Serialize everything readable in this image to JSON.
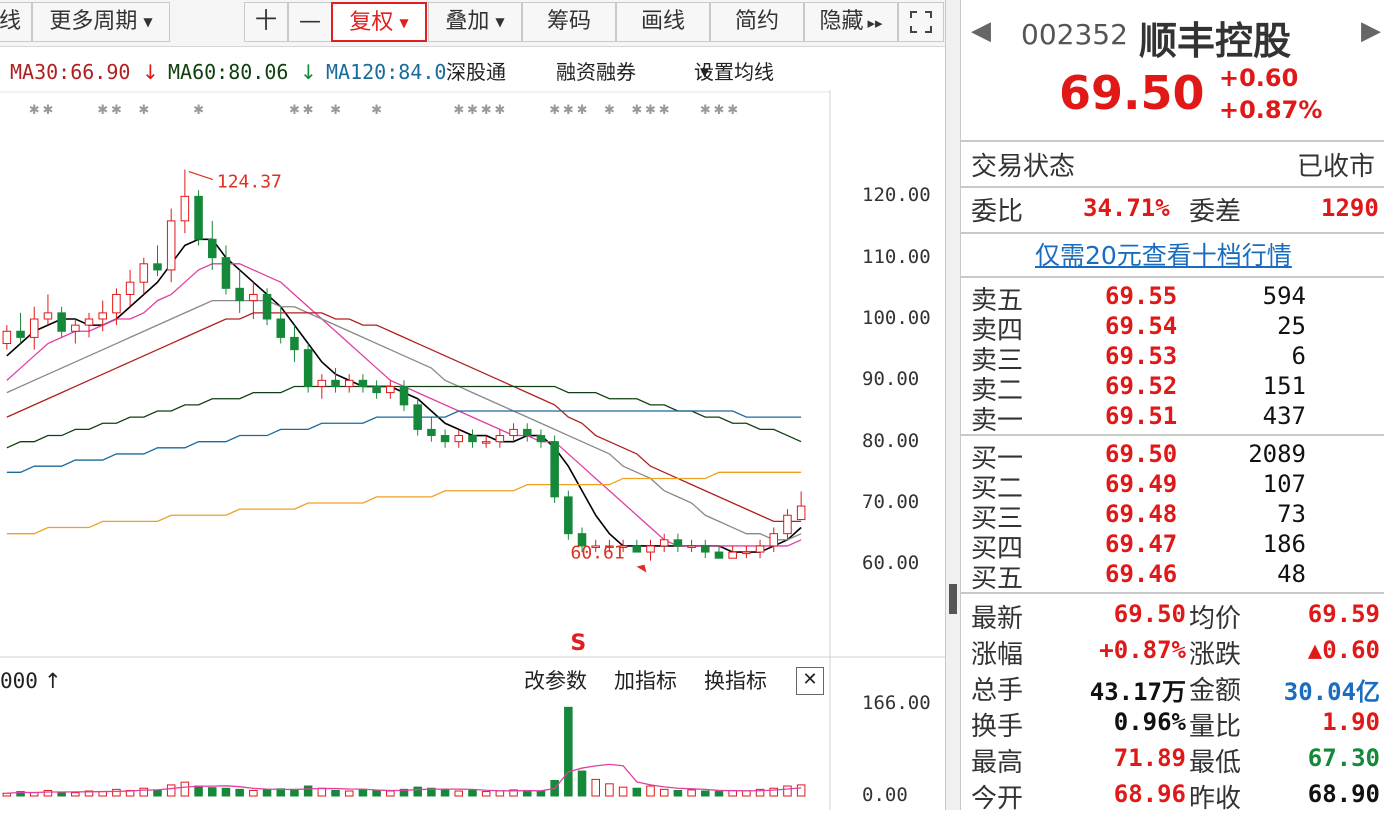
{
  "toolbar": {
    "left_partial": "线",
    "period": "更多周期",
    "plus": "十",
    "minus": "—",
    "restore_rights": "复权",
    "overlay": "叠加",
    "chips": "筹码",
    "draw": "画线",
    "simple": "简约",
    "hide": "隐藏",
    "hide_arrows": "▸▸"
  },
  "ma_row": {
    "ma30": "MA30:66.90",
    "ma30_arrow": "↓",
    "ma60": "MA60:80.06",
    "ma60_arrow": "↓",
    "ma120": "MA120:84.0",
    "shenzhen_connect": "深股通",
    "margin": "融资融券",
    "set_ma": "设置均线"
  },
  "chart_data": {
    "type": "candlestick",
    "y_ticks": [
      "120.00",
      "110.00",
      "100.00",
      "90.00",
      "80.00",
      "70.00",
      "60.00"
    ],
    "ylim": [
      55,
      130
    ],
    "high_annotation": "124.37",
    "low_annotation": "60.61",
    "signal_marker": "S",
    "candles": [
      [
        96,
        99,
        95,
        98
      ],
      [
        98,
        101,
        96,
        97
      ],
      [
        97,
        102,
        95,
        100
      ],
      [
        100,
        104,
        99,
        101
      ],
      [
        101,
        102,
        97,
        98
      ],
      [
        98,
        100,
        96,
        99
      ],
      [
        99,
        101,
        97,
        100
      ],
      [
        100,
        103,
        98,
        101
      ],
      [
        101,
        105,
        99,
        104
      ],
      [
        104,
        108,
        102,
        106
      ],
      [
        106,
        110,
        104,
        109
      ],
      [
        109,
        112,
        107,
        108
      ],
      [
        108,
        118,
        106,
        116
      ],
      [
        116,
        124.37,
        114,
        120
      ],
      [
        120,
        121,
        112,
        113
      ],
      [
        113,
        116,
        108,
        110
      ],
      [
        110,
        112,
        104,
        105
      ],
      [
        105,
        108,
        101,
        103
      ],
      [
        103,
        106,
        100,
        104
      ],
      [
        104,
        105,
        99,
        100
      ],
      [
        100,
        102,
        96,
        97
      ],
      [
        97,
        99,
        93,
        95
      ],
      [
        95,
        96,
        88,
        89
      ],
      [
        89,
        91,
        87,
        90
      ],
      [
        90,
        92,
        88,
        89
      ],
      [
        89,
        91,
        88,
        90
      ],
      [
        90,
        91,
        88,
        89
      ],
      [
        89,
        90,
        87,
        88
      ],
      [
        88,
        90,
        87,
        89
      ],
      [
        89,
        90,
        85,
        86
      ],
      [
        86,
        87,
        81,
        82
      ],
      [
        82,
        84,
        80,
        81
      ],
      [
        81,
        82,
        79,
        80
      ],
      [
        80,
        82,
        79,
        81
      ],
      [
        81,
        82,
        79,
        80
      ],
      [
        80,
        81,
        79,
        80
      ],
      [
        80,
        82,
        79,
        81
      ],
      [
        81,
        83,
        80,
        82
      ],
      [
        82,
        83,
        80,
        81
      ],
      [
        81,
        82,
        79,
        80
      ],
      [
        80,
        81,
        70,
        71
      ],
      [
        71,
        72,
        64,
        65
      ],
      [
        65,
        66,
        62,
        63
      ],
      [
        63,
        64,
        62,
        63
      ],
      [
        63,
        64,
        62,
        63
      ],
      [
        63,
        64,
        62,
        63
      ],
      [
        63,
        64,
        62,
        62
      ],
      [
        62,
        64,
        60.61,
        63
      ],
      [
        63,
        65,
        62,
        64
      ],
      [
        64,
        65,
        62,
        63
      ],
      [
        63,
        64,
        62,
        63
      ],
      [
        63,
        64,
        61,
        62
      ],
      [
        62,
        63,
        61,
        61
      ],
      [
        61,
        63,
        61,
        62
      ],
      [
        62,
        63,
        61,
        62
      ],
      [
        62,
        64,
        61,
        63
      ],
      [
        63,
        66,
        62,
        65
      ],
      [
        65,
        69,
        64,
        68
      ],
      [
        67.3,
        71.89,
        67.3,
        69.5
      ]
    ],
    "ma_series": [
      {
        "name": "MA5",
        "color": "#000000",
        "values": [
          94,
          96,
          98,
          99,
          100,
          100,
          99,
          99,
          100,
          102,
          104,
          106,
          109,
          112,
          113,
          113,
          110,
          108,
          106,
          104,
          102,
          99,
          96,
          93,
          91,
          90,
          89,
          89,
          89,
          88,
          87,
          85,
          83,
          82,
          81,
          81,
          80,
          80,
          81,
          81,
          79,
          76,
          72,
          68,
          65,
          63,
          63,
          63,
          63,
          63,
          63,
          63,
          63,
          62,
          62,
          62,
          63,
          64,
          66
        ]
      },
      {
        "name": "MA10",
        "color": "#e040a0",
        "values": [
          90,
          92,
          94,
          96,
          97,
          98,
          98,
          99,
          100,
          100,
          101,
          103,
          104,
          106,
          108,
          109,
          109,
          109,
          108,
          107,
          106,
          104,
          102,
          100,
          98,
          96,
          94,
          92,
          90,
          89,
          88,
          87,
          86,
          85,
          84,
          83,
          82,
          81,
          81,
          80,
          80,
          78,
          76,
          74,
          72,
          70,
          68,
          66,
          64,
          63,
          63,
          63,
          63,
          63,
          63,
          63,
          63,
          63,
          64
        ]
      },
      {
        "name": "MA20",
        "color": "#888888",
        "values": [
          88,
          89,
          90,
          91,
          92,
          93,
          94,
          95,
          96,
          97,
          98,
          99,
          100,
          101,
          102,
          103,
          103,
          103,
          103,
          103,
          102,
          102,
          101,
          100,
          99,
          98,
          97,
          96,
          95,
          94,
          93,
          92,
          90,
          89,
          88,
          87,
          86,
          85,
          84,
          83,
          82,
          81,
          80,
          79,
          78,
          76,
          75,
          74,
          72,
          71,
          70,
          68,
          67,
          66,
          65,
          65,
          64,
          64,
          65
        ]
      },
      {
        "name": "MA30",
        "color": "#b02020",
        "values": [
          84,
          85,
          86,
          87,
          88,
          89,
          90,
          91,
          92,
          93,
          94,
          95,
          96,
          97,
          98,
          99,
          100,
          100,
          101,
          101,
          101,
          101,
          101,
          101,
          100,
          100,
          99,
          99,
          98,
          97,
          96,
          95,
          94,
          93,
          92,
          91,
          90,
          89,
          88,
          87,
          86,
          84,
          83,
          81,
          80,
          79,
          78,
          76,
          75,
          74,
          73,
          72,
          71,
          70,
          69,
          68,
          67,
          67,
          67
        ]
      },
      {
        "name": "MA60",
        "color": "#104010",
        "values": [
          79,
          80,
          80,
          81,
          81,
          82,
          82,
          83,
          83,
          84,
          84,
          85,
          85,
          86,
          86,
          87,
          87,
          87,
          88,
          88,
          88,
          89,
          89,
          89,
          89,
          89,
          89,
          89,
          89,
          89,
          89,
          89,
          89,
          89,
          89,
          89,
          89,
          89,
          89,
          89,
          89,
          88,
          88,
          88,
          87,
          87,
          87,
          86,
          86,
          85,
          85,
          84,
          84,
          83,
          83,
          82,
          82,
          81,
          80
        ]
      },
      {
        "name": "MA120",
        "color": "#1a6a9a",
        "values": [
          75,
          75,
          76,
          76,
          76,
          77,
          77,
          77,
          78,
          78,
          78,
          79,
          79,
          79,
          80,
          80,
          80,
          81,
          81,
          81,
          82,
          82,
          82,
          83,
          83,
          83,
          83,
          84,
          84,
          84,
          84,
          84,
          84,
          85,
          85,
          85,
          85,
          85,
          85,
          85,
          85,
          85,
          85,
          85,
          85,
          85,
          85,
          85,
          85,
          85,
          85,
          85,
          85,
          85,
          84,
          84,
          84,
          84,
          84
        ]
      },
      {
        "name": "MA250",
        "color": "#f0a020",
        "values": [
          65,
          65,
          65,
          66,
          66,
          66,
          66,
          67,
          67,
          67,
          67,
          67,
          68,
          68,
          68,
          68,
          68,
          69,
          69,
          69,
          69,
          69,
          70,
          70,
          70,
          70,
          70,
          71,
          71,
          71,
          71,
          71,
          72,
          72,
          72,
          72,
          72,
          72,
          73,
          73,
          73,
          73,
          73,
          73,
          73,
          74,
          74,
          74,
          74,
          74,
          74,
          74,
          75,
          75,
          75,
          75,
          75,
          75,
          75
        ]
      }
    ]
  },
  "volume": {
    "partial_label": "000",
    "arrow": "↑",
    "edit_params": "改参数",
    "add_indicator": "加指标",
    "switch_indicator": "换指标",
    "close_symbol": "✕",
    "y_ticks": [
      "166.00",
      "0.00"
    ],
    "ylim": [
      0,
      166
    ],
    "values": [
      5,
      8,
      6,
      10,
      7,
      6,
      9,
      8,
      12,
      10,
      14,
      11,
      20,
      25,
      18,
      15,
      14,
      12,
      10,
      11,
      13,
      12,
      18,
      14,
      10,
      9,
      11,
      10,
      9,
      12,
      16,
      14,
      11,
      9,
      10,
      8,
      9,
      11,
      10,
      9,
      28,
      160,
      45,
      30,
      22,
      16,
      14,
      18,
      12,
      10,
      11,
      9,
      8,
      10,
      9,
      12,
      14,
      18,
      20
    ]
  },
  "quote": {
    "prev": "◀",
    "next": "▶",
    "code": "002352",
    "name": "顺丰控股",
    "price": "69.50",
    "change": "+0.60",
    "change_pct": "+0.87%",
    "status_label": "交易状态",
    "status_value": "已收市",
    "weibi_label": "委比",
    "weibi_value": "34.71%",
    "weicha_label": "委差",
    "weicha_value": "1290",
    "level2_link": "仅需20元查看十档行情",
    "asks": [
      {
        "label": "卖五",
        "price": "69.55",
        "vol": "594"
      },
      {
        "label": "卖四",
        "price": "69.54",
        "vol": "25"
      },
      {
        "label": "卖三",
        "price": "69.53",
        "vol": "6"
      },
      {
        "label": "卖二",
        "price": "69.52",
        "vol": "151"
      },
      {
        "label": "卖一",
        "price": "69.51",
        "vol": "437"
      }
    ],
    "bids": [
      {
        "label": "买一",
        "price": "69.50",
        "vol": "2089"
      },
      {
        "label": "买二",
        "price": "69.49",
        "vol": "107"
      },
      {
        "label": "买三",
        "price": "69.48",
        "vol": "73"
      },
      {
        "label": "买四",
        "price": "69.47",
        "vol": "186"
      },
      {
        "label": "买五",
        "price": "69.46",
        "vol": "48"
      }
    ],
    "stats": [
      {
        "l1": "最新",
        "v1": "69.50",
        "c1": "red",
        "l2": "均价",
        "v2": "69.59",
        "c2": "red"
      },
      {
        "l1": "涨幅",
        "v1": "+0.87%",
        "c1": "red",
        "l2": "涨跌",
        "v2": "▲0.60",
        "c2": "red"
      },
      {
        "l1": "总手",
        "v1": "43.17万",
        "c1": "black",
        "l2": "金额",
        "v2": "30.04亿",
        "c2": "blue"
      },
      {
        "l1": "换手",
        "v1": "0.96%",
        "c1": "black",
        "l2": "量比",
        "v2": "1.90",
        "c2": "red"
      },
      {
        "l1": "最高",
        "v1": "71.89",
        "c1": "red",
        "l2": "最低",
        "v2": "67.30",
        "c2": "green"
      },
      {
        "l1": "今开",
        "v1": "68.96",
        "c1": "red",
        "l2": "昨收",
        "v2": "68.90",
        "c2": "black"
      }
    ]
  },
  "colors": {
    "up": "#e01818",
    "down": "#16883a",
    "accent": "#e02020"
  }
}
